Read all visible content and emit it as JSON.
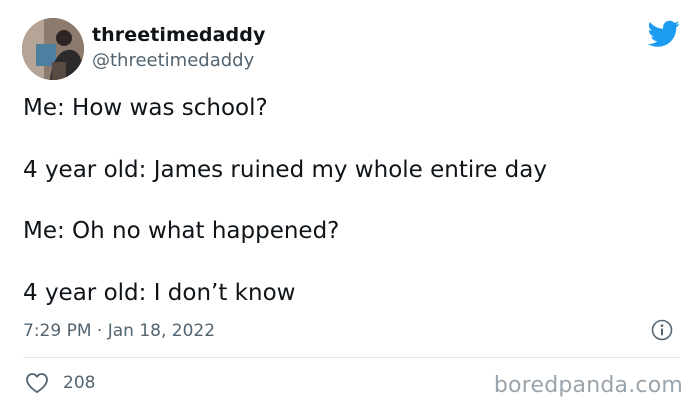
{
  "user": {
    "display_name": "threetimedaddy",
    "handle": "@threetimedaddy",
    "avatar_icon": "profile-photo"
  },
  "brand": {
    "logo_icon": "twitter-bird-icon",
    "accent_color": "#1d9bf0"
  },
  "tweet": {
    "lines": [
      "Me: How was school?",
      "4 year old: James ruined my whole entire day",
      "Me: Oh no what happened?",
      "4 year old: I don’t know"
    ],
    "timestamp": "7:29 PM · Jan 18, 2022",
    "info_icon": "info-icon"
  },
  "engagement": {
    "like_icon": "heart-icon",
    "like_count": "208"
  },
  "watermark": {
    "text": "boredpanda.com"
  }
}
